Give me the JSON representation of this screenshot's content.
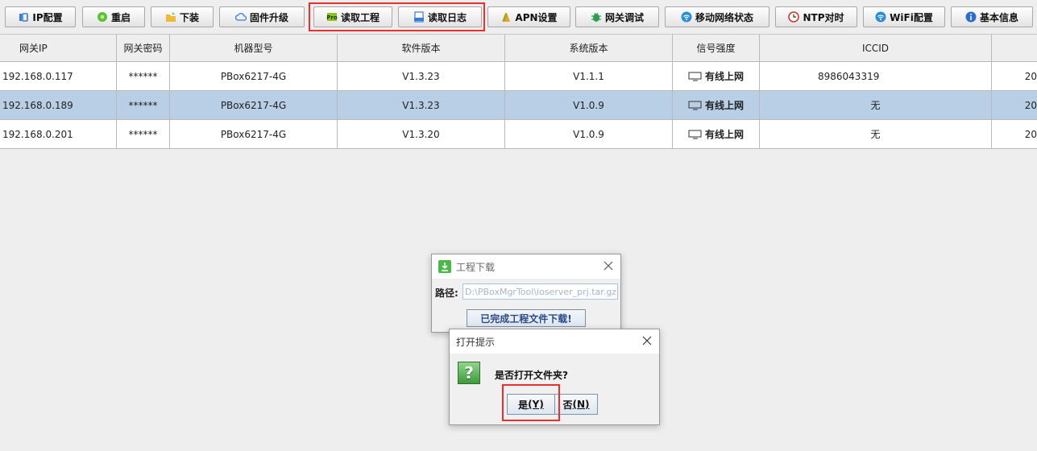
{
  "toolbar": {
    "buttons": [
      {
        "label": "IP配置",
        "icon": "ip-config-icon"
      },
      {
        "label": "重启",
        "icon": "restart-icon"
      },
      {
        "label": "下装",
        "icon": "download-folder-icon"
      },
      {
        "label": "固件升级",
        "icon": "cloud-icon"
      },
      {
        "label": "读取工程",
        "icon": "pro-file-icon"
      },
      {
        "label": "读取日志",
        "icon": "log-file-icon"
      },
      {
        "label": "APN设置",
        "icon": "apn-icon"
      },
      {
        "label": "网关调试",
        "icon": "bug-icon"
      },
      {
        "label": "移动网络状态",
        "icon": "wifi-icon"
      },
      {
        "label": "NTP对时",
        "icon": "clock-icon"
      },
      {
        "label": "WiFi配置",
        "icon": "wifi-icon"
      },
      {
        "label": "基本信息",
        "icon": "info-icon"
      }
    ]
  },
  "table": {
    "headers": [
      "网关IP",
      "网关密码",
      "机器型号",
      "软件版本",
      "系统版本",
      "信号强度",
      "ICCID",
      ""
    ],
    "rows": [
      {
        "ip": "192.168.0.117",
        "password": "******",
        "model": "PBox6217-4G",
        "software": "V1.3.23",
        "system": "V1.1.1",
        "signal": "有线上网",
        "iccid": "8986043319",
        "extra": "20"
      },
      {
        "ip": "192.168.0.189",
        "password": "******",
        "model": "PBox6217-4G",
        "software": "V1.3.23",
        "system": "V1.0.9",
        "signal": "有线上网",
        "iccid": "无",
        "extra": "20"
      },
      {
        "ip": "192.168.0.201",
        "password": "******",
        "model": "PBox6217-4G",
        "software": "V1.3.20",
        "system": "V1.0.9",
        "signal": "有线上网",
        "iccid": "无",
        "extra": "20"
      }
    ],
    "selected_row": 1
  },
  "download_dialog": {
    "title": "工程下载",
    "path_label": "路径:",
    "path_value": "D:\\PBoxMgrTool\\ioserver_prj.tar.gz",
    "status": "已完成工程文件下载!"
  },
  "open_dialog": {
    "title": "打开提示",
    "icon_char": "?",
    "message": "是否打开文件夹?",
    "yes": {
      "label": "是",
      "mnemonic": "(Y)"
    },
    "no": {
      "label": "否",
      "mnemonic": "(N)"
    }
  },
  "colors": {
    "highlight": "#e8312e",
    "selected_row": "#b8cfe5"
  }
}
